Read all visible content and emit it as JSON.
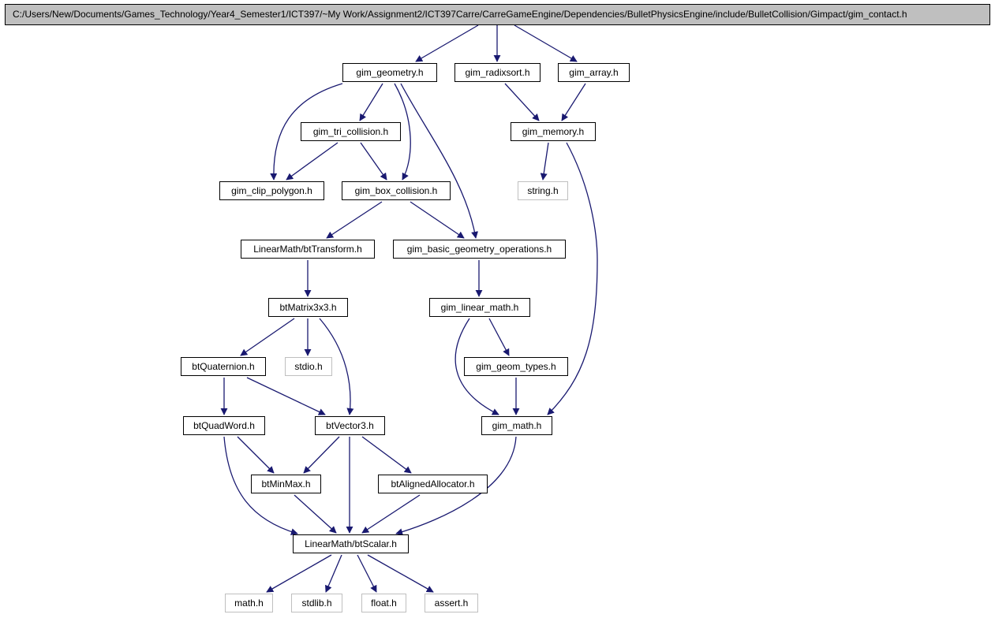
{
  "title": "C:/Users/New/Documents/Games_Technology/Year4_Semester1/ICT397/~My Work/Assignment2/ICT397Carre/CarreGameEngine/Dependencies/BulletPhysicsEngine/include/BulletCollision/Gimpact/gim_contact.h",
  "colors": {
    "edge": "#191970",
    "root_fill": "#bfbfbf",
    "external_border": "#bfbfbf"
  },
  "nodes": {
    "geom": "gim_geometry.h",
    "radix": "gim_radixsort.h",
    "array": "gim_array.h",
    "tri": "gim_tri_collision.h",
    "memory": "gim_memory.h",
    "clip": "gim_clip_polygon.h",
    "box": "gim_box_collision.h",
    "string": "string.h",
    "transform": "LinearMath/btTransform.h",
    "basic": "gim_basic_geometry_operations.h",
    "matrix": "btMatrix3x3.h",
    "linmath": "gim_linear_math.h",
    "quat": "btQuaternion.h",
    "stdio": "stdio.h",
    "geomtypes": "gim_geom_types.h",
    "quadword": "btQuadWord.h",
    "vector3": "btVector3.h",
    "math": "gim_math.h",
    "minmax": "btMinMax.h",
    "aligned": "btAlignedAllocator.h",
    "scalar": "LinearMath/btScalar.h",
    "mathh": "math.h",
    "stdlib": "stdlib.h",
    "float": "float.h",
    "assert": "assert.h"
  }
}
